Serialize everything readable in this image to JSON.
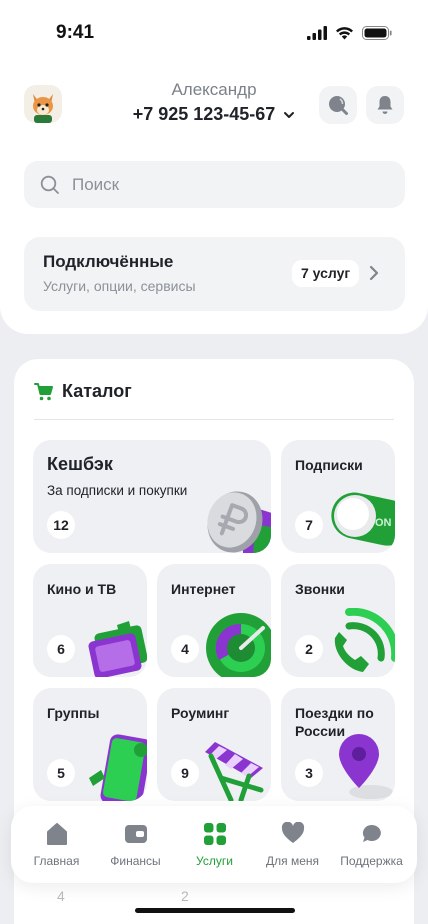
{
  "status_bar": {
    "time": "9:41"
  },
  "header": {
    "user_name": "Александр",
    "phone": "+7 925 123-45-67"
  },
  "search": {
    "placeholder": "Поиск"
  },
  "connected": {
    "title": "Подключённые",
    "subtitle": "Услуги, опции, сервисы",
    "badge": "7 услуг"
  },
  "catalog": {
    "title": "Каталог",
    "tiles": [
      {
        "title": "Кешбэк",
        "subtitle": "За подписки и покупки",
        "count": "12"
      },
      {
        "title": "Подписки",
        "count": "7"
      },
      {
        "title": "Кино и ТВ",
        "count": "6"
      },
      {
        "title": "Интернет",
        "count": "4"
      },
      {
        "title": "Звонки",
        "count": "2"
      },
      {
        "title": "Группы",
        "count": "5"
      },
      {
        "title": "Роуминг",
        "count": "9"
      },
      {
        "title": "Поездки по России",
        "count": "3"
      }
    ],
    "peek_counts": [
      "4",
      "2"
    ]
  },
  "bottom_nav": {
    "items": [
      {
        "label": "Главная",
        "icon": "home-icon"
      },
      {
        "label": "Финансы",
        "icon": "wallet-icon"
      },
      {
        "label": "Услуги",
        "icon": "grid-icon",
        "active": true
      },
      {
        "label": "Для меня",
        "icon": "heart-icon"
      },
      {
        "label": "Поддержка",
        "icon": "chat-icon"
      }
    ]
  },
  "colors": {
    "accent": "#21a038",
    "accent_purple": "#8a35d0"
  }
}
